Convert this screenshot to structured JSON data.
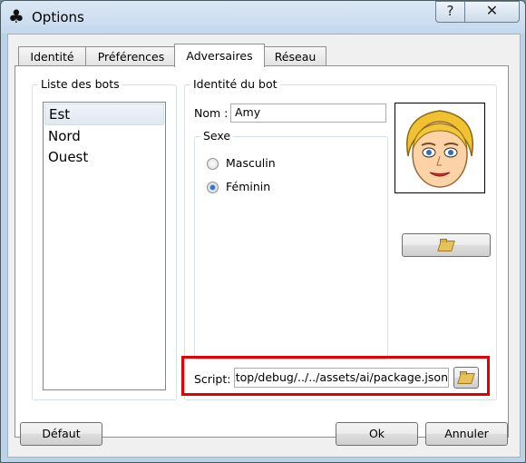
{
  "window": {
    "title": "Options",
    "icon": "club-icon"
  },
  "titlebar": {
    "help_label": "?",
    "close_label": "✕"
  },
  "tabs": [
    {
      "label": "Identité",
      "active": false
    },
    {
      "label": "Préférences",
      "active": false
    },
    {
      "label": "Adversaires",
      "active": true
    },
    {
      "label": "Réseau",
      "active": false
    }
  ],
  "bots_group": {
    "title": "Liste des bots",
    "items": [
      {
        "label": "Est",
        "selected": true
      },
      {
        "label": "Nord",
        "selected": false
      },
      {
        "label": "Ouest",
        "selected": false
      }
    ]
  },
  "identity_group": {
    "title": "Identité du bot",
    "name_label": "Nom :",
    "name_value": "Amy",
    "sex_group": {
      "title": "Sexe",
      "options": [
        {
          "label": "Masculin",
          "checked": false
        },
        {
          "label": "Féminin",
          "checked": true
        }
      ]
    },
    "script_label": "Script:",
    "script_value": "esktop/debug/../../assets/ai/package.json"
  },
  "footer": {
    "default_label": "Défaut",
    "ok_label": "Ok",
    "cancel_label": "Annuler"
  },
  "colors": {
    "highlight": "#e20000",
    "selected_radio": "#2b74c6"
  }
}
